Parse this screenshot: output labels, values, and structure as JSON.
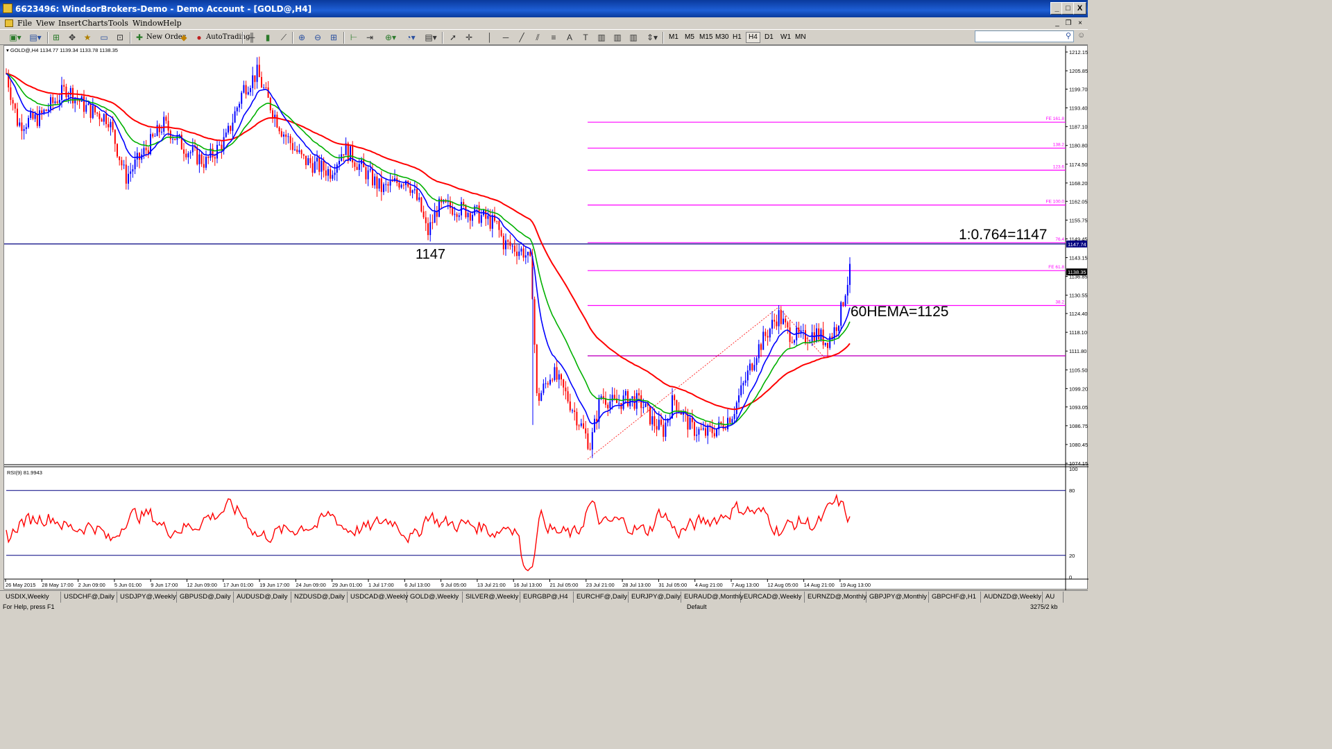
{
  "window": {
    "title": "6623496: WindsorBrokers-Demo - Demo Account - [GOLD@,H4]",
    "controls": [
      "_",
      "□",
      "X"
    ]
  },
  "menu": {
    "items": [
      "File",
      "View",
      "Insert",
      "Charts",
      "Tools",
      "Window",
      "Help"
    ]
  },
  "toolbar": {
    "new_order": "New Order",
    "autotrading": "AutoTrading",
    "timeframes": [
      "M1",
      "M5",
      "M15",
      "M30",
      "H1",
      "H4",
      "D1",
      "W1",
      "MN"
    ],
    "active_timeframe": "H4"
  },
  "chart": {
    "header": "GOLD@,H4  1134.77 1139.34 1133.78 1138.35",
    "rsi_header": "RSI(9) 81.9943",
    "annotations": {
      "ratio": "1:0.764=1147",
      "level_1147": "1147",
      "hema": "60HEMA=1125"
    },
    "price_labels": [
      "1212.15",
      "1205.85",
      "1199.70",
      "1193.40",
      "1187.10",
      "1180.80",
      "1174.50",
      "1168.20",
      "1162.05",
      "1155.75",
      "1149.45",
      "1143.15",
      "1136.85",
      "1130.55",
      "1124.40",
      "1118.10",
      "1111.80",
      "1105.50",
      "1099.20",
      "1093.05",
      "1086.75",
      "1080.45",
      "1074.15"
    ],
    "current_price": "1138.35",
    "hline_price": "1147.74",
    "rsi_scale": [
      "100",
      "80",
      "20",
      "0"
    ],
    "fib_labels": [
      "FE 161.8",
      "138.2",
      "123.6",
      "FE 100.0",
      "76.4",
      "FE 61.8",
      "38.2"
    ],
    "x_labels": [
      "26 May 2015",
      "28 May 17:00",
      "2 Jun 09:00",
      "5 Jun 01:00",
      "9 Jun 17:00",
      "12 Jun 09:00",
      "17 Jun 01:00",
      "19 Jun 17:00",
      "24 Jun 09:00",
      "29 Jun 01:00",
      "1 Jul 17:00",
      "6 Jul 13:00",
      "9 Jul 05:00",
      "13 Jul 21:00",
      "16 Jul 13:00",
      "21 Jul 05:00",
      "23 Jul 21:00",
      "28 Jul 13:00",
      "31 Jul 05:00",
      "4 Aug 21:00",
      "7 Aug 13:00",
      "12 Aug 05:00",
      "14 Aug 21:00",
      "19 Aug 13:00"
    ],
    "colors": {
      "bull": "#0000ff",
      "bear": "#ff0000",
      "ema_fast": "#0000ff",
      "ema_mid": "#00b000",
      "ema_slow": "#ff0000",
      "fib": "#ff00ff",
      "hline": "#000080",
      "rsi": "#ff0000"
    }
  },
  "tabs": [
    "USDIX,Weekly",
    "USDCHF@,Daily",
    "USDJPY@,Weekly",
    "GBPUSD@,Daily",
    "AUDUSD@,Daily",
    "NZDUSD@,Daily",
    "USDCAD@,Weekly",
    "GOLD@,Weekly",
    "SILVER@,Weekly",
    "EURGBP@,H4",
    "EURCHF@,Daily",
    "EURJPY@,Daily",
    "EURAUD@,Monthly",
    "EURCAD@,Weekly",
    "EURNZD@,Monthly",
    "GBPJPY@,Monthly",
    "GBPCHF@,H1",
    "AUDNZD@,Weekly",
    "AU"
  ],
  "status": {
    "help": "For Help, press F1",
    "profile": "Default",
    "traffic": "3275/2 kb"
  }
}
